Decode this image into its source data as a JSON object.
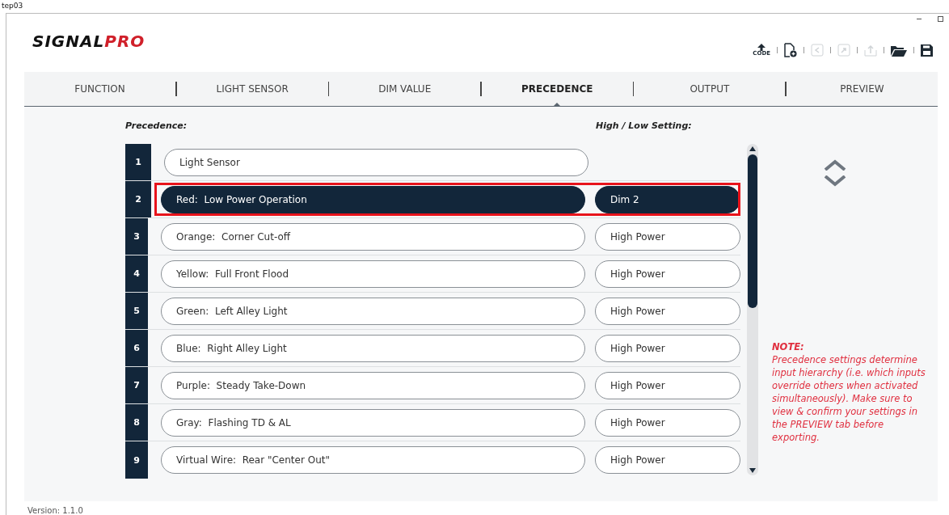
{
  "window": {
    "title": "tep03"
  },
  "logo": {
    "dark": "SIGNAL",
    "accent": "PRO"
  },
  "toolbar": [
    {
      "kind": "code",
      "label": "CODE",
      "disabled": false
    },
    {
      "kind": "new",
      "disabled": false
    },
    {
      "kind": "undo",
      "disabled": true
    },
    {
      "kind": "redo",
      "disabled": true
    },
    {
      "kind": "export",
      "disabled": true
    },
    {
      "kind": "open",
      "disabled": false
    },
    {
      "kind": "save",
      "disabled": false
    }
  ],
  "tabs": [
    {
      "label": "FUNCTION",
      "selected": false
    },
    {
      "label": "LIGHT SENSOR",
      "selected": false
    },
    {
      "label": "DIM VALUE",
      "selected": false
    },
    {
      "label": "PRECEDENCE",
      "selected": true
    },
    {
      "label": "OUTPUT",
      "selected": false
    },
    {
      "label": "PREVIEW",
      "selected": false
    }
  ],
  "precedence_heading": "Precedence:",
  "setting_heading": "High / Low Setting:",
  "rows": [
    {
      "number": "1",
      "input": "Light Sensor",
      "selected": false
    },
    {
      "number": "2",
      "input": "Red:  Low Power Operation",
      "setting": "Dim 2",
      "selected": true
    },
    {
      "number": "3",
      "input": "Orange:  Corner Cut-off",
      "setting": "High Power",
      "selected": false
    },
    {
      "number": "4",
      "input": "Yellow:  Full Front Flood",
      "setting": "High Power",
      "selected": false
    },
    {
      "number": "5",
      "input": "Green:  Left Alley Light",
      "setting": "High Power",
      "selected": false
    },
    {
      "number": "6",
      "input": "Blue:  Right Alley Light",
      "setting": "High Power",
      "selected": false
    },
    {
      "number": "7",
      "input": "Purple:  Steady Take-Down",
      "setting": "High Power",
      "selected": false
    },
    {
      "number": "8",
      "input": "Gray:  Flashing TD & AL",
      "setting": "High Power",
      "selected": false
    },
    {
      "number": "9",
      "input": "Virtual Wire:  Rear \"Center Out\"",
      "setting": "High Power",
      "selected": false
    }
  ],
  "note": {
    "title": "NOTE:",
    "text": "Precedence settings determine input hierarchy (i.e. which inputs override others when activated simultaneously). Make sure to view & confirm your settings in the PREVIEW tab before exporting."
  },
  "version": "Version: 1.1.0"
}
